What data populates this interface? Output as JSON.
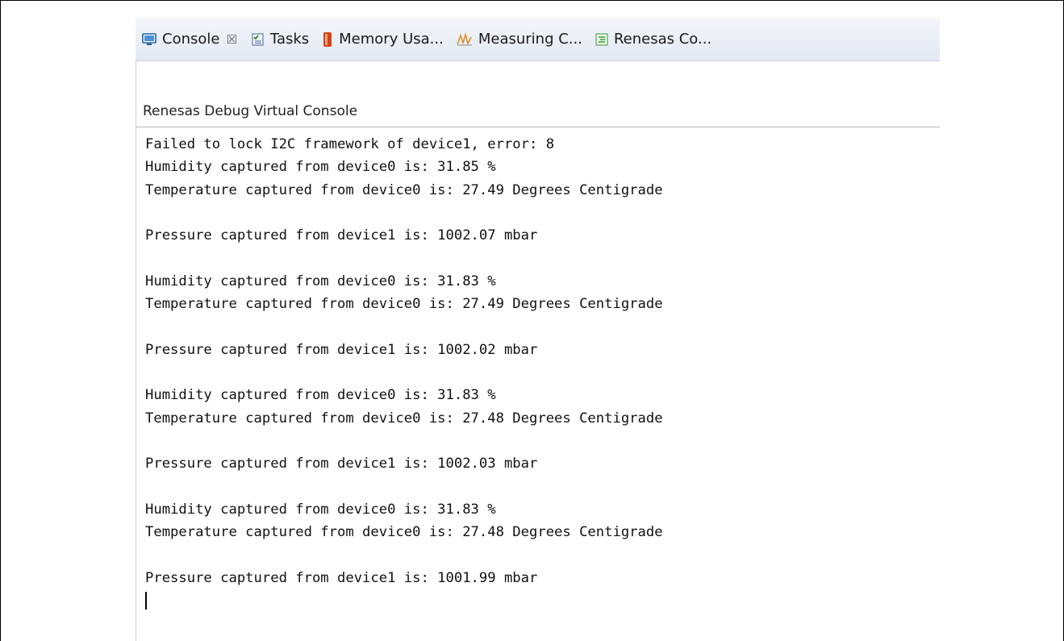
{
  "tabs": [
    {
      "label": "Console",
      "icon": "console-icon",
      "active": true,
      "close": "☒"
    },
    {
      "label": "Tasks",
      "icon": "tasks-icon"
    },
    {
      "label": "Memory Usa...",
      "icon": "memory-icon"
    },
    {
      "label": "Measuring C...",
      "icon": "measuring-icon"
    },
    {
      "label": "Renesas Co...",
      "icon": "renesas-icon"
    }
  ],
  "console": {
    "title": "Renesas Debug Virtual Console",
    "lines": [
      "Failed to lock I2C framework of device1, error: 8",
      "Humidity captured from device0 is: 31.85 %",
      "Temperature captured from device0 is: 27.49 Degrees Centigrade",
      "",
      "Pressure captured from device1 is: 1002.07 mbar",
      "",
      "Humidity captured from device0 is: 31.83 %",
      "Temperature captured from device0 is: 27.49 Degrees Centigrade",
      "",
      "Pressure captured from device1 is: 1002.02 mbar",
      "",
      "Humidity captured from device0 is: 31.83 %",
      "Temperature captured from device0 is: 27.48 Degrees Centigrade",
      "",
      "Pressure captured from device1 is: 1002.03 mbar",
      "",
      "Humidity captured from device0 is: 31.83 %",
      "Temperature captured from device0 is: 27.48 Degrees Centigrade",
      "",
      "Pressure captured from device1 is: 1001.99 mbar"
    ]
  },
  "colors": {
    "tabbar_bg": "#e2e9f3",
    "console_icon": "#1f5fa8",
    "memory_icon": "#d6441a",
    "measuring_icon": "#e08a1e",
    "renesas_icon": "#3a9b3a"
  }
}
